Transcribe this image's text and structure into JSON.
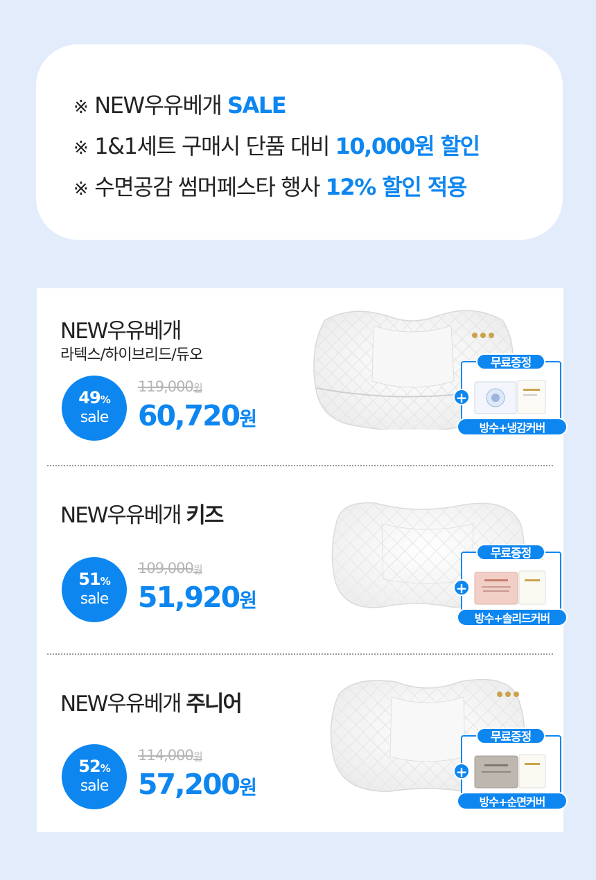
{
  "notice": {
    "mark": "※",
    "lines": [
      {
        "text": "NEW우유베개",
        "highlight": "SALE"
      },
      {
        "text": "1&1세트 구매시 단품 대비",
        "highlight": "10,000원 할인"
      },
      {
        "text": "수면공감 썸머페스타 행사",
        "highlight": "12% 할인 적용"
      }
    ]
  },
  "accent_color": "#0d86f0",
  "products": [
    {
      "title": "NEW우유베개",
      "title_bold": "",
      "subtitle": "라텍스/하이브리드/듀오",
      "discount_num": "49",
      "discount_pct": "%",
      "sale_word": "sale",
      "original_price": "119,000",
      "original_unit": "원",
      "price": "60,720",
      "price_unit": "원",
      "gift_badge": "무료증정",
      "gift_plus": "+",
      "gift_label": "방수+냉감커버"
    },
    {
      "title": "NEW우유베개",
      "title_bold": "키즈",
      "subtitle": "",
      "discount_num": "51",
      "discount_pct": "%",
      "sale_word": "sale",
      "original_price": "109,000",
      "original_unit": "원",
      "price": "51,920",
      "price_unit": "원",
      "gift_badge": "무료증정",
      "gift_plus": "+",
      "gift_label": "방수+솔리드커버"
    },
    {
      "title": "NEW우유베개",
      "title_bold": "주니어",
      "subtitle": "",
      "discount_num": "52",
      "discount_pct": "%",
      "sale_word": "sale",
      "original_price": "114,000",
      "original_unit": "원",
      "price": "57,200",
      "price_unit": "원",
      "gift_badge": "무료증정",
      "gift_plus": "+",
      "gift_label": "방수+순면커버"
    }
  ]
}
